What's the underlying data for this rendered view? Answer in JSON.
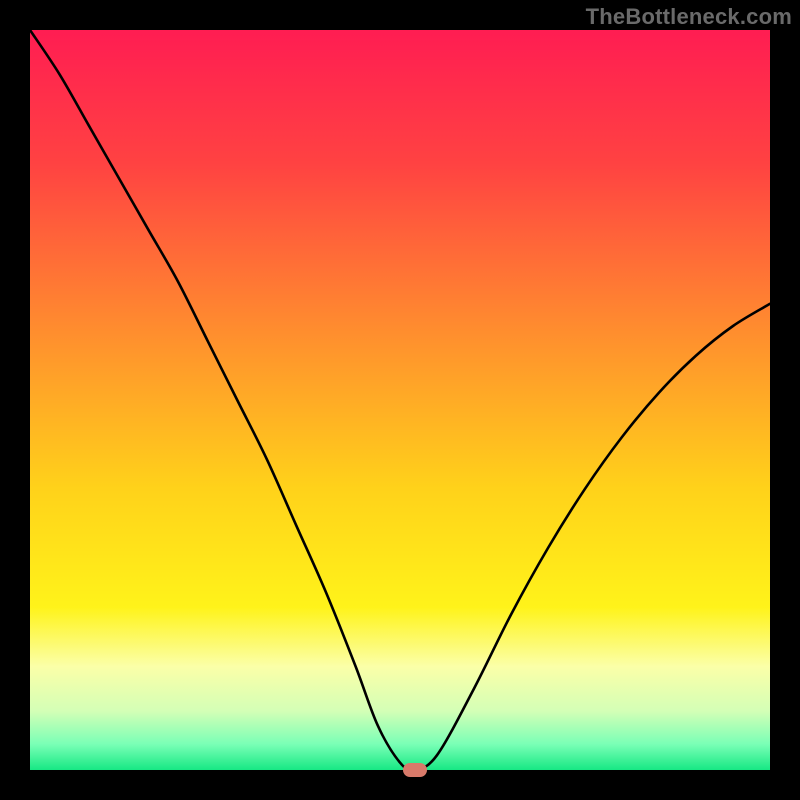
{
  "watermark": {
    "text": "TheBottleneck.com"
  },
  "chart_data": {
    "type": "line",
    "title": "",
    "xlabel": "",
    "ylabel": "",
    "xlim": [
      0,
      100
    ],
    "ylim": [
      0,
      100
    ],
    "grid": false,
    "legend": false,
    "background_gradient_stops": [
      {
        "pct": 0,
        "color": "#ff1d52"
      },
      {
        "pct": 18,
        "color": "#ff4242"
      },
      {
        "pct": 40,
        "color": "#ff8b2f"
      },
      {
        "pct": 62,
        "color": "#ffd21a"
      },
      {
        "pct": 78,
        "color": "#fff31a"
      },
      {
        "pct": 86,
        "color": "#fbffa8"
      },
      {
        "pct": 92,
        "color": "#d4ffb6"
      },
      {
        "pct": 96.5,
        "color": "#7affb6"
      },
      {
        "pct": 100,
        "color": "#17e884"
      }
    ],
    "series": [
      {
        "name": "bottleneck-curve",
        "x": [
          0,
          4,
          8,
          12,
          16,
          20,
          24,
          28,
          32,
          36,
          40,
          44,
          47,
          50,
          52,
          55,
          60,
          65,
          70,
          75,
          80,
          85,
          90,
          95,
          100
        ],
        "y": [
          100,
          94,
          87,
          80,
          73,
          66,
          58,
          50,
          42,
          33,
          24,
          14,
          6,
          1,
          0,
          2,
          11,
          21,
          30,
          38,
          45,
          51,
          56,
          60,
          63
        ]
      }
    ],
    "marker": {
      "x": 52,
      "y": 0,
      "color": "#d87a6a"
    }
  }
}
